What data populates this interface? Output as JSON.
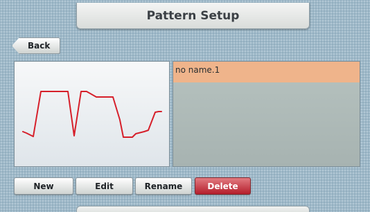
{
  "header": {
    "title": "Pattern Setup"
  },
  "nav": {
    "back_label": "Back"
  },
  "pattern_list": {
    "items": [
      {
        "name": "no name.1",
        "selected": true
      }
    ],
    "selected_color": "#efb48b"
  },
  "preview": {
    "line_color": "#d61f2a"
  },
  "actions": {
    "new_label": "New",
    "edit_label": "Edit",
    "rename_label": "Rename",
    "delete_label": "Delete",
    "delete_color": "#c22a36"
  }
}
